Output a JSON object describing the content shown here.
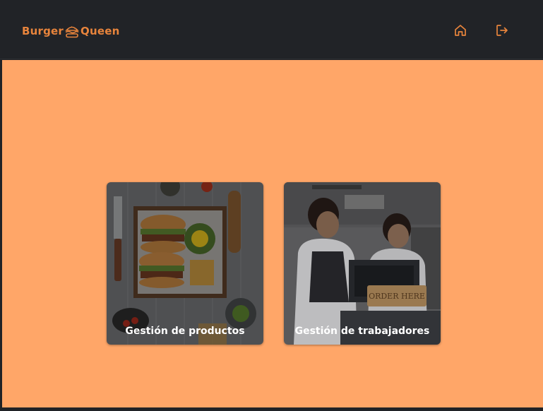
{
  "brand": {
    "name_left": "Burger",
    "name_right": "Queen",
    "accent_color": "#e8843c",
    "logo_icon": "burger-icon"
  },
  "navbar": {
    "background": "#212327",
    "icons": [
      "home-icon",
      "logout-icon"
    ]
  },
  "main": {
    "background": "#ffa668"
  },
  "cards": [
    {
      "label": "Gestión de productos",
      "image": "burger-platter-photo"
    },
    {
      "label": "Gestión de trabajadores",
      "image": "cashiers-photo",
      "sign_text": "ORDER HERE"
    }
  ]
}
